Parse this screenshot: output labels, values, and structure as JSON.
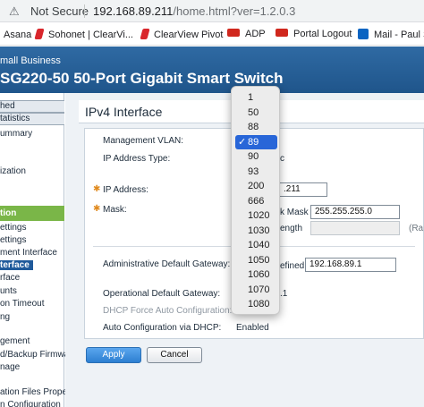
{
  "browser": {
    "security_label": "Not Secure",
    "url_host": "192.168.89.211",
    "url_path": "/home.html?ver=1.2.0.3",
    "bookmarks": [
      {
        "label": "Asana",
        "icon": "asana-icon",
        "color": "#f06a6a"
      },
      {
        "label": "Sohonet | ClearVi...",
        "icon": "sohonet-icon",
        "color": "#d9262c"
      },
      {
        "label": "ClearView Pivot",
        "icon": "clearview-icon",
        "color": "#d9262c"
      },
      {
        "label": "ADP",
        "icon": "adp-icon",
        "color": "#d0271d"
      },
      {
        "label": "Portal Logout",
        "icon": "adp-icon",
        "color": "#d0271d"
      },
      {
        "label": "Mail - Paul S",
        "icon": "outlook-icon",
        "color": "#0a64c2"
      }
    ]
  },
  "header": {
    "brand": "mall Business",
    "product": "SG220-50 50-Port Gigabit Smart Switch"
  },
  "sidebar": {
    "items": [
      {
        "label": "hed",
        "style": "box"
      },
      {
        "label": "tatistics",
        "style": "box"
      },
      {
        "label": "ummary",
        "style": "plain"
      },
      {
        "label": "ization",
        "style": "plain"
      },
      {
        "label": "tion",
        "style": "green"
      },
      {
        "label": "ettings",
        "style": "plain"
      },
      {
        "label": "ettings",
        "style": "plain"
      },
      {
        "label": "ment Interface",
        "style": "plain"
      },
      {
        "label": "terface",
        "style": "selected"
      },
      {
        "label": "rface",
        "style": "plain"
      },
      {
        "label": "unts",
        "style": "plain"
      },
      {
        "label": "on Timeout",
        "style": "plain"
      },
      {
        "label": "ng",
        "style": "plain"
      },
      {
        "label": "gement",
        "style": "plain"
      },
      {
        "label": "d/Backup Firmwa",
        "style": "plain"
      },
      {
        "label": "nage",
        "style": "plain"
      },
      {
        "label": "ation Files Prope",
        "style": "plain"
      },
      {
        "label": "n Configuration",
        "style": "plain"
      }
    ]
  },
  "main": {
    "title": "IPv4 Interface",
    "management_vlan_label": "Management VLAN:",
    "ip_address_type_label": "IP Address Type:",
    "ip_address_type_value_tail": "c",
    "ip_address_label": "IP Address:",
    "ip_address_value_tail": ".211",
    "mask_label": "Mask:",
    "mask_option_label": "k Mask",
    "mask_value": "255.255.255.0",
    "prefix_length_label": "ength",
    "admin_gateway_label": "Administrative Default Gateway:",
    "admin_gateway_option": "efined",
    "admin_gateway_value": "192.168.89.1",
    "operational_gateway_label": "Operational Default Gateway:",
    "operational_gateway_value_tail": ".1",
    "dhcp_force_label": "DHCP Force Auto Configuration:",
    "auto_config_label": "Auto Configuration via DHCP:",
    "auto_config_value": "Enabled",
    "right_edge_label": "(Ra",
    "apply_label": "Apply",
    "cancel_label": "Cancel"
  },
  "vlan_dropdown": {
    "options": [
      "1",
      "50",
      "88",
      "89",
      "90",
      "93",
      "200",
      "666",
      "1020",
      "1030",
      "1040",
      "1050",
      "1060",
      "1070",
      "1080"
    ],
    "selected": "89",
    "check_glyph": "✓"
  },
  "colors": {
    "header_blue": "#1f558b",
    "nav_selected": "#1f5a9b",
    "nav_green": "#7ab648",
    "required_star": "#e08a1e",
    "menu_highlight": "#2866d8"
  }
}
